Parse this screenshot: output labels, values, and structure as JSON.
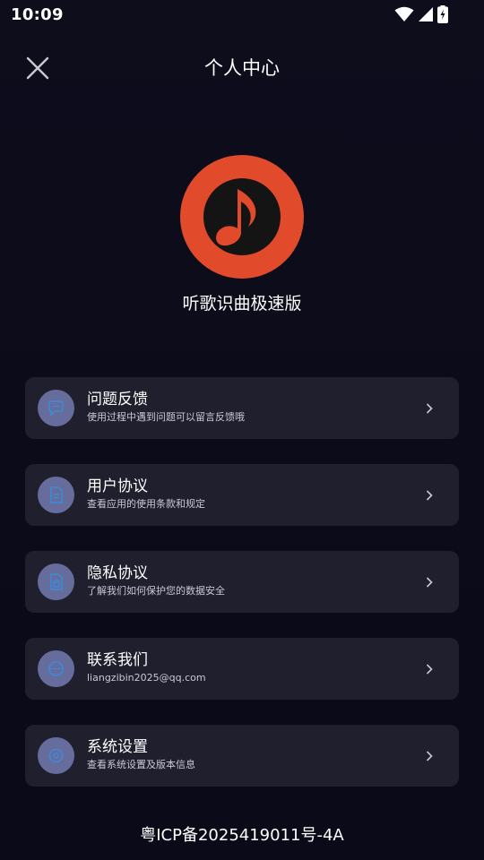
{
  "status_bar": {
    "time": "10:09"
  },
  "header": {
    "title": "个人中心"
  },
  "app": {
    "name": "听歌识曲极速版",
    "logo_color": "#e24a2c",
    "logo_icon": "music-note-icon"
  },
  "menu": {
    "items": [
      {
        "title": "问题反馈",
        "subtitle": "使用过程中遇到问题可以留言反馈哦",
        "icon": "feedback-icon"
      },
      {
        "title": "用户协议",
        "subtitle": "查看应用的使用条款和规定",
        "icon": "document-icon"
      },
      {
        "title": "隐私协议",
        "subtitle": "了解我们如何保护您的数据安全",
        "icon": "privacy-icon"
      },
      {
        "title": "联系我们",
        "subtitle": "liangzibin2025@qq.com",
        "icon": "contact-icon"
      },
      {
        "title": "系统设置",
        "subtitle": "查看系统设置及版本信息",
        "icon": "settings-icon"
      }
    ]
  },
  "footer": {
    "icp": "粤ICP备2025419011号-4A"
  },
  "colors": {
    "background": "#0b0b1a",
    "card": "#1f1f2e",
    "icon_circle": "#666c9c",
    "icon_glyph": "#3d8bd6"
  }
}
